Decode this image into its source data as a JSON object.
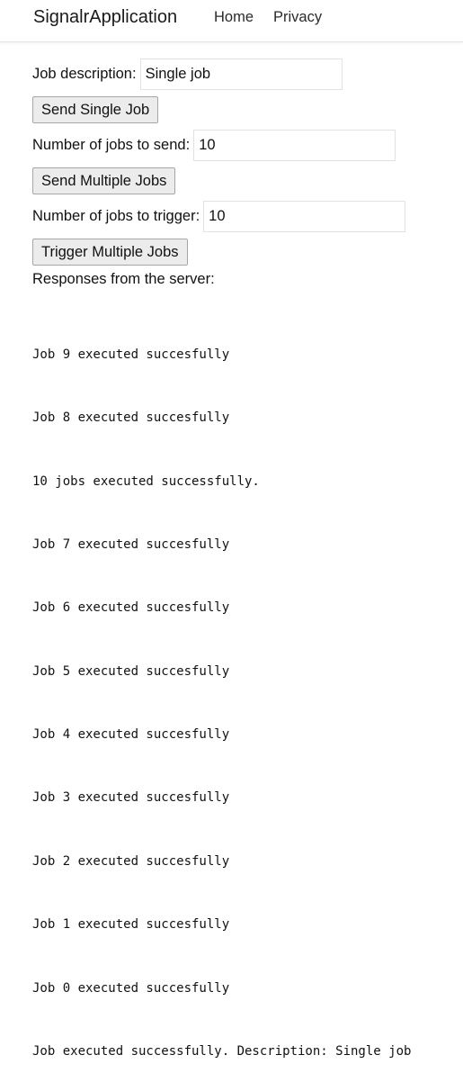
{
  "navbar": {
    "brand": "SignalrApplication",
    "links": [
      "Home",
      "Privacy"
    ]
  },
  "form": {
    "job_description_label": "Job description:",
    "job_description_value": "Single job",
    "send_single_label": "Send Single Job",
    "num_send_label": "Number of jobs to send:",
    "num_send_value": "10",
    "send_multiple_label": "Send Multiple Jobs",
    "num_trigger_label": "Number of jobs to trigger:",
    "num_trigger_value": "10",
    "trigger_multiple_label": "Trigger Multiple Jobs"
  },
  "responses": {
    "label": "Responses from the server:",
    "items": [
      "Job 9 executed succesfully",
      "Job 8 executed succesfully",
      "10 jobs executed successfully.",
      "Job 7 executed succesfully",
      "Job 6 executed succesfully",
      "Job 5 executed succesfully",
      "Job 4 executed succesfully",
      "Job 3 executed succesfully",
      "Job 2 executed succesfully",
      "Job 1 executed succesfully",
      "Job 0 executed succesfully",
      "Job executed successfully. Description: Single job"
    ]
  }
}
